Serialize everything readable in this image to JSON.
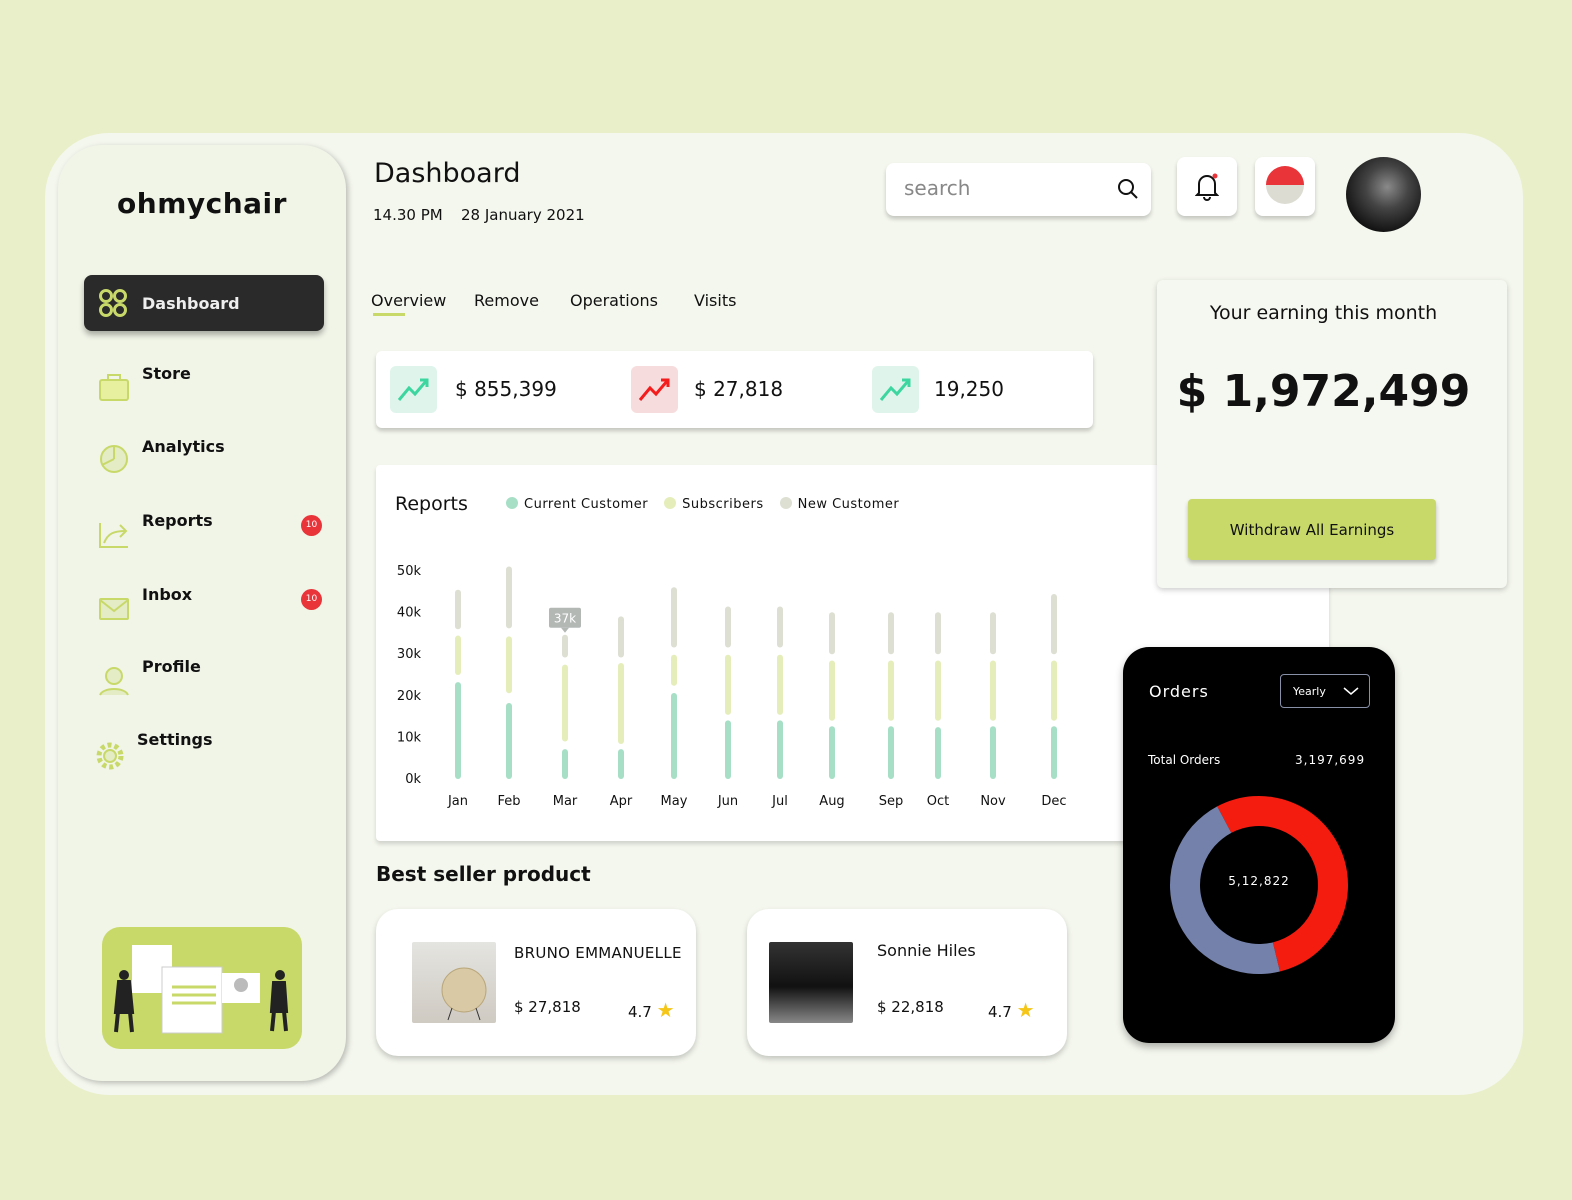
{
  "brand": "ohmychair",
  "sidebar": {
    "items": [
      {
        "label": "Dashboard",
        "icon": "grid-icon",
        "active": true
      },
      {
        "label": "Store",
        "icon": "bag-icon"
      },
      {
        "label": "Analytics",
        "icon": "pie-icon"
      },
      {
        "label": "Reports",
        "icon": "share-chart-icon",
        "badge": "10"
      },
      {
        "label": "Inbox",
        "icon": "mail-icon",
        "badge": "10"
      },
      {
        "label": "Profile",
        "icon": "user-icon"
      },
      {
        "label": "Settings",
        "icon": "gear-icon"
      }
    ]
  },
  "header": {
    "title": "Dashboard",
    "time": "14.30 PM",
    "date": "28 January 2021",
    "search_placeholder": "search"
  },
  "tabs": [
    "Overview",
    "Remove",
    "Operations",
    "Visits"
  ],
  "stats": [
    {
      "value": "$ 855,399",
      "trend": "up",
      "color": "#3ed6a0"
    },
    {
      "value": "$ 27,818",
      "trend": "up",
      "color": "#f41c1c"
    },
    {
      "value": "19,250",
      "trend": "up",
      "color": "#3ed6a0"
    }
  ],
  "earnings": {
    "label": "Your earning this month",
    "value": "$ 1,972,499",
    "button": "Withdraw All Earnings"
  },
  "best_seller": {
    "title": "Best seller product",
    "products": [
      {
        "name": "BRUNO EMMANUELLE",
        "price": "$ 27,818",
        "rating": "4.7"
      },
      {
        "name": "Sonnie Hiles",
        "price": "$ 22,818",
        "rating": "4.7"
      }
    ]
  },
  "orders": {
    "title": "Orders",
    "period": "Yearly",
    "total_label": "Total Orders",
    "total_value": "3,197,699",
    "center_value": "5,12,822"
  },
  "chart_data": [
    {
      "type": "bar",
      "title": "Reports",
      "ylim": [
        0,
        50
      ],
      "yticks": [
        "0k",
        "10k",
        "20k",
        "30k",
        "40k",
        "50k"
      ],
      "categories": [
        "Jan",
        "Feb",
        "Mar",
        "Apr",
        "May",
        "Jun",
        "Jul",
        "Aug",
        "Sep",
        "Oct",
        "Nov",
        "Dec"
      ],
      "tooltip": {
        "category": "Mar",
        "label": "37k"
      },
      "series": [
        {
          "name": "Current Customer",
          "color": "#a6dfc6",
          "ranges": [
            [
              0,
              22.8
            ],
            [
              0,
              17.8
            ],
            [
              0,
              6.7
            ],
            [
              0,
              6.7
            ],
            [
              0,
              20.2
            ],
            [
              0,
              13.6
            ],
            [
              0,
              13.6
            ],
            [
              0,
              12.2
            ],
            [
              0,
              12.2
            ],
            [
              0,
              12
            ],
            [
              0,
              12.2
            ],
            [
              0,
              12.2
            ]
          ]
        },
        {
          "name": "Subscribers",
          "color": "#e5edbb",
          "ranges": [
            [
              25,
              34
            ],
            [
              20.6,
              33.8
            ],
            [
              9,
              27
            ],
            [
              8.4,
              27.4
            ],
            [
              22.4,
              29.4
            ],
            [
              15.4,
              29.4
            ],
            [
              15.4,
              29.4
            ],
            [
              14,
              28
            ],
            [
              14,
              28
            ],
            [
              14,
              28
            ],
            [
              14,
              28
            ],
            [
              14,
              28
            ]
          ]
        },
        {
          "name": "New Customer",
          "color": "#dcdfd2",
          "ranges": [
            [
              36,
              45
            ],
            [
              36.2,
              50.6
            ],
            [
              29.2,
              34.2
            ],
            [
              29.2,
              38.6
            ],
            [
              31.6,
              45.6
            ],
            [
              31.6,
              41
            ],
            [
              31.6,
              41
            ],
            [
              30,
              39.6
            ],
            [
              30,
              39.6
            ],
            [
              30,
              39.6
            ],
            [
              30,
              39.6
            ],
            [
              30,
              44
            ]
          ]
        }
      ]
    },
    {
      "type": "pie",
      "title": "Orders",
      "slices": [
        {
          "name": "red",
          "value": 54,
          "color": "#f41c0f"
        },
        {
          "name": "blue",
          "value": 46,
          "color": "#7482ab"
        }
      ]
    }
  ]
}
